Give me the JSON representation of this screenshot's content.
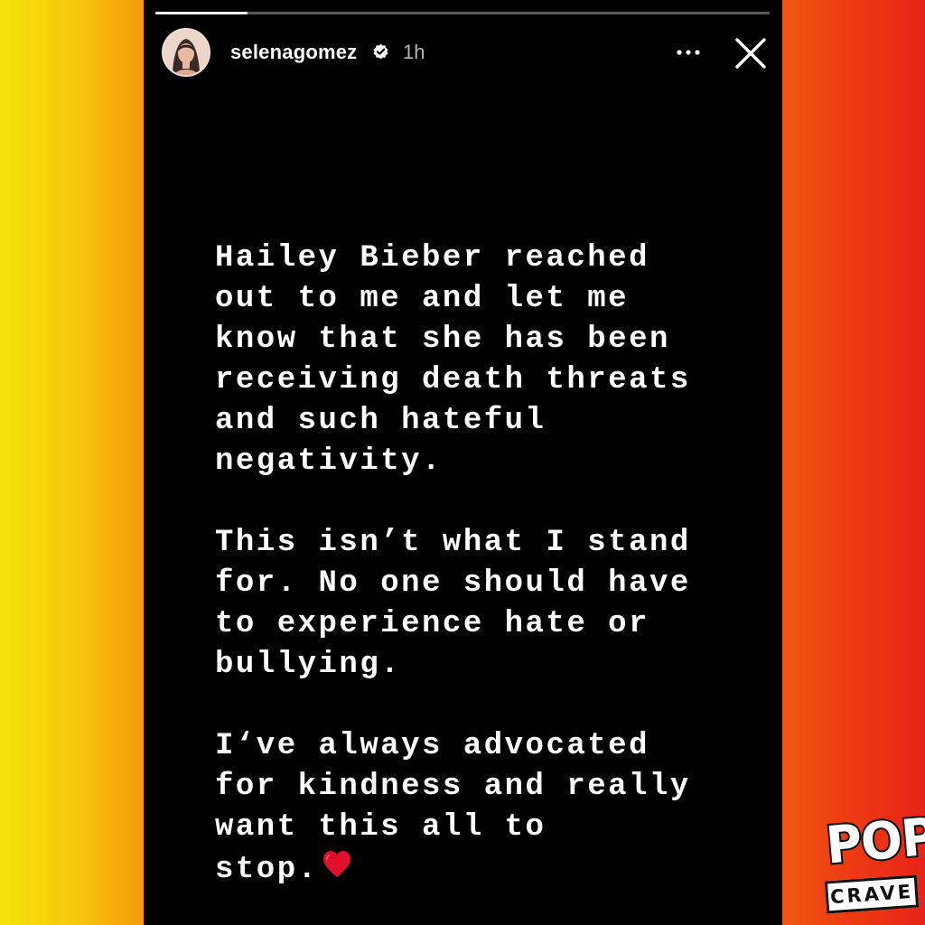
{
  "story": {
    "progress": 0.15,
    "user": {
      "username": "selenagomez",
      "verified": true,
      "posted_ago": "1h"
    },
    "icons": {
      "verified": "verified-badge-icon",
      "more": "more-options-icon",
      "close": "close-icon",
      "heart": "red-heart-icon"
    },
    "paragraphs": [
      "Hailey Bieber reached\nout to me and let me\nknow that she has been\nreceiving death threats\nand such hateful\nnegativity.",
      "This isn’t what I stand\nfor. No one should have\nto experience hate or\nbullying.",
      "I‘ve always advocated\nfor kindness and really\nwant this all to\nstop."
    ]
  },
  "colors": {
    "background_left": "#f4e20a",
    "background_right": "#e8241a",
    "story_background": "#000000",
    "text": "#ffffff",
    "heart": "#e0102a"
  },
  "branding": {
    "logo_line1": "POP",
    "logo_line2": "CRAVE"
  }
}
